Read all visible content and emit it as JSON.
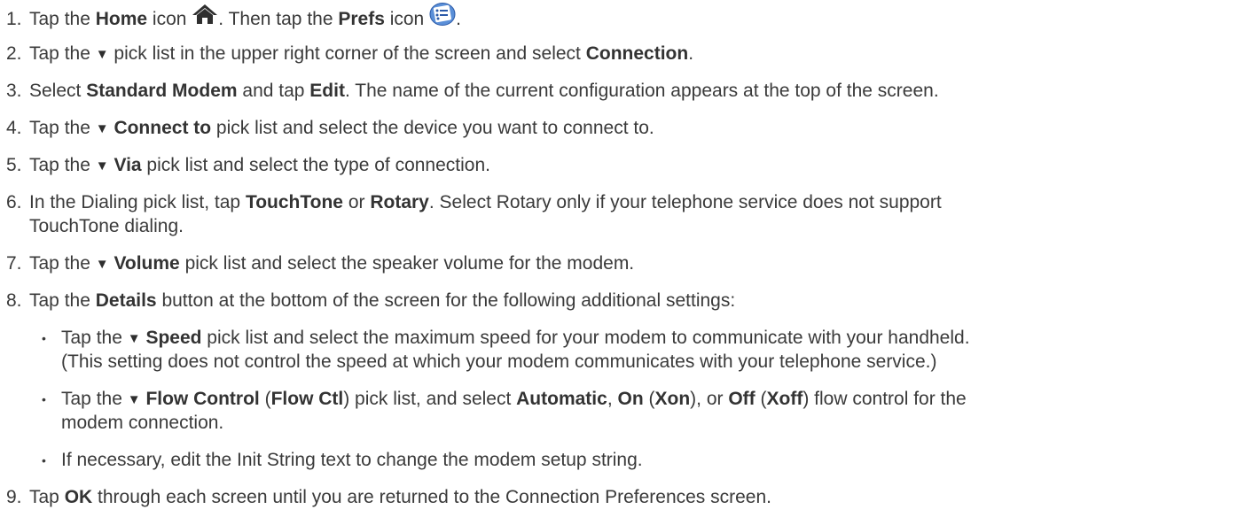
{
  "steps": {
    "s1": {
      "num": "1.",
      "a": "Tap the ",
      "home_label": "Home",
      "b": " icon ",
      "c": ". Then tap the ",
      "prefs_label": "Prefs",
      "d": " icon ",
      "e": "."
    },
    "s2": {
      "num": "2.",
      "a": "Tap the ",
      "b": " pick list in the upper right corner of the screen and select ",
      "connection": "Connection",
      "c": "."
    },
    "s3": {
      "num": "3.",
      "a": "Select ",
      "standard_modem": "Standard Modem",
      "b": " and tap ",
      "edit": "Edit",
      "c": ". The name of the current configuration appears at the top of the screen."
    },
    "s4": {
      "num": "4.",
      "a": "Tap the ",
      "connect_to": "Connect to",
      "b": " pick list and select the device you want to connect to."
    },
    "s5": {
      "num": "5.",
      "a": "Tap the ",
      "via": "Via",
      "b": " pick list and select the type of connection."
    },
    "s6": {
      "num": "6.",
      "a": "In the Dialing pick list, tap ",
      "touchtone": "TouchTone",
      "b": " or ",
      "rotary": "Rotary",
      "c": ". Select Rotary only if your telephone service does not support",
      "cont": "TouchTone dialing."
    },
    "s7": {
      "num": "7.",
      "a": "Tap the ",
      "volume": "Volume",
      "b": " pick list and select the speaker volume for the modem."
    },
    "s8": {
      "num": "8.",
      "a": "Tap the ",
      "details": "Details",
      "b": " button at the bottom of the screen for the following additional settings:",
      "bullets": {
        "b1": {
          "a": "Tap the ",
          "speed": "Speed",
          "b": " pick list and select the maximum speed for your modem to communicate with your handheld.",
          "cont": "(This setting does not control the speed at which your modem communicates with your telephone service.)"
        },
        "b2": {
          "a": "Tap the ",
          "flow_control": "Flow Control",
          "b": " (",
          "flow_ctl": "Flow Ctl",
          "c": ") pick list, and select ",
          "automatic": "Automatic",
          "d": ", ",
          "on": "On",
          "e": " (",
          "xon": "Xon",
          "f": "), or ",
          "off": "Off",
          "g": " (",
          "xoff": "Xoff",
          "h": ") flow control for the",
          "cont": "modem connection."
        },
        "b3": {
          "text": "If necessary, edit the Init String text to change the modem setup string."
        }
      }
    },
    "s9": {
      "num": "9.",
      "a": "Tap ",
      "ok": "OK",
      "b": " through each screen until you are returned to the Connection Preferences screen."
    }
  },
  "glyphs": {
    "triangle": "▼",
    "bullet": "•"
  },
  "icons": {
    "home": "home-icon",
    "prefs": "prefs-icon"
  }
}
